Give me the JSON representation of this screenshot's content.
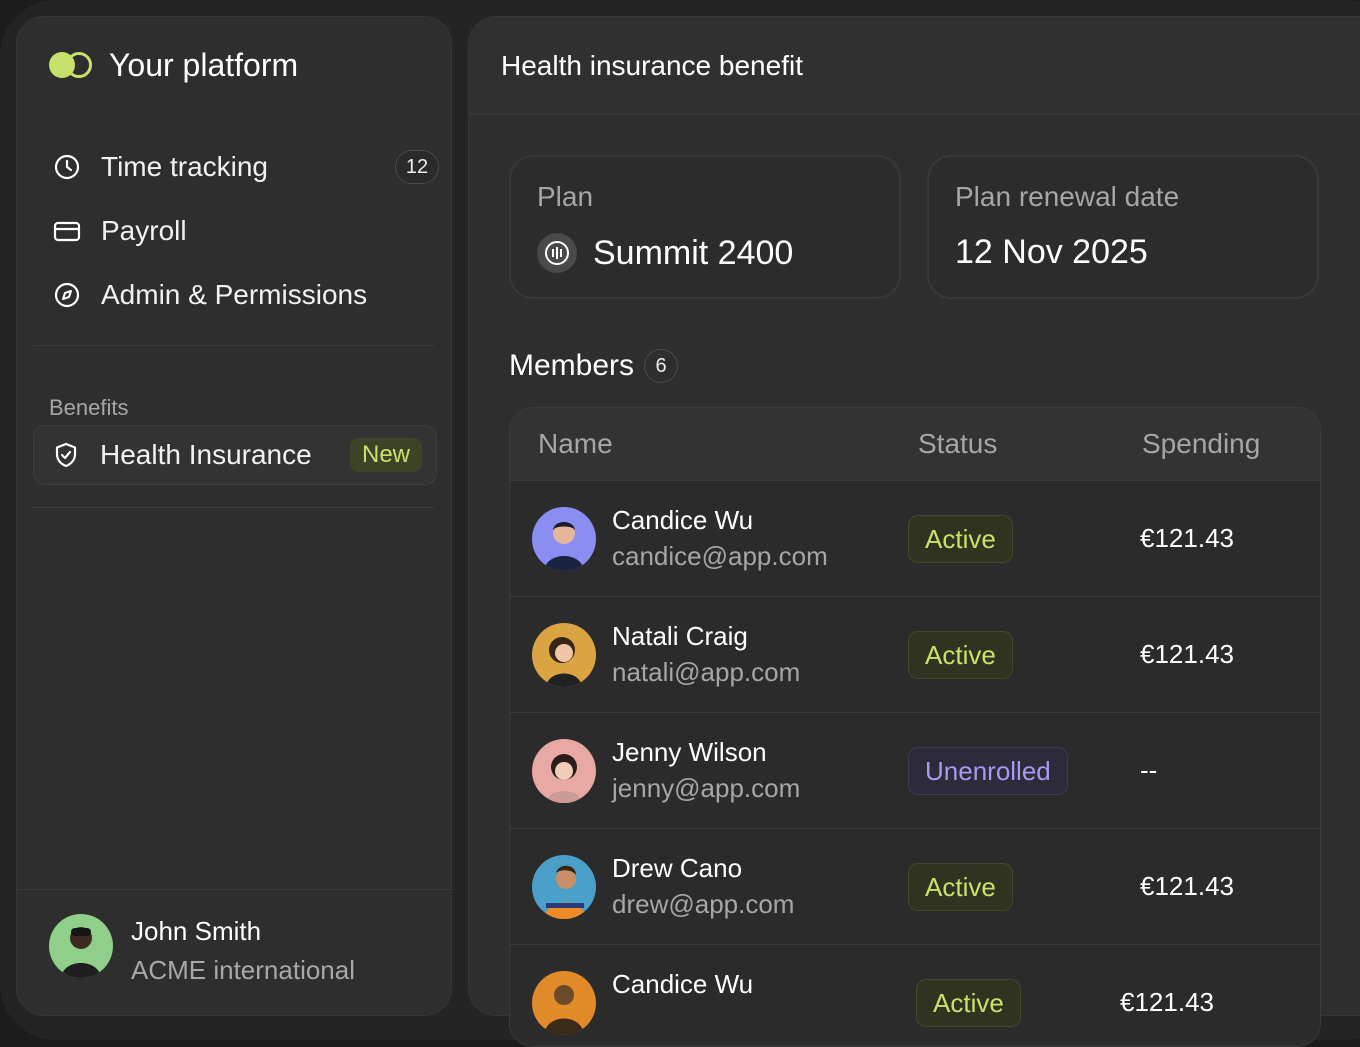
{
  "brand": {
    "title": "Your platform",
    "accent": "#c7e26a"
  },
  "nav": {
    "items": [
      {
        "label": "Time tracking",
        "icon": "clock-icon",
        "count": "12"
      },
      {
        "label": "Payroll",
        "icon": "credit-card-icon"
      },
      {
        "label": "Admin & Permissions",
        "icon": "compass-icon"
      }
    ],
    "section_label": "Benefits",
    "active_item": {
      "label": "Health Insurance",
      "icon": "shield-check-icon",
      "badge": "New"
    }
  },
  "user": {
    "name": "John Smith",
    "org": "ACME international"
  },
  "main": {
    "title": "Health insurance benefit",
    "plan": {
      "label": "Plan",
      "value": "Summit 2400"
    },
    "renewal": {
      "label": "Plan renewal date",
      "value": "12 Nov 2025"
    },
    "members": {
      "title": "Members",
      "count": "6"
    },
    "table": {
      "columns": [
        "Name",
        "Status",
        "Spending"
      ],
      "rows": [
        {
          "name": "Candice Wu",
          "email": "candice@app.com",
          "status": "Active",
          "spending": "€121.43"
        },
        {
          "name": "Natali Craig",
          "email": "natali@app.com",
          "status": "Active",
          "spending": "€121.43"
        },
        {
          "name": "Jenny Wilson",
          "email": "jenny@app.com",
          "status": "Unenrolled",
          "spending": "--"
        },
        {
          "name": "Drew Cano",
          "email": "drew@app.com",
          "status": "Active",
          "spending": "€121.43"
        },
        {
          "name": "Candice Wu",
          "email": "",
          "status": "Active",
          "spending": "€121.43"
        }
      ]
    }
  }
}
